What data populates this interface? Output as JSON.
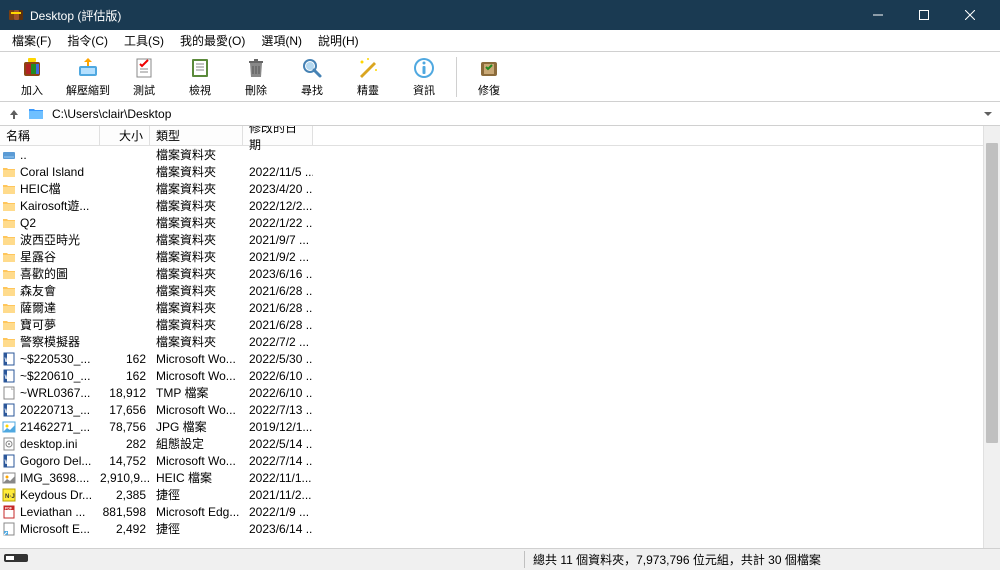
{
  "titlebar": {
    "title": "Desktop (評估版)"
  },
  "menubar": {
    "items": [
      {
        "label": "檔案(F)"
      },
      {
        "label": "指令(C)"
      },
      {
        "label": "工具(S)"
      },
      {
        "label": "我的最愛(O)"
      },
      {
        "label": "選項(N)"
      },
      {
        "label": "說明(H)"
      }
    ]
  },
  "toolbar": {
    "buttons": [
      {
        "label": "加入",
        "icon": "add"
      },
      {
        "label": "解壓縮到",
        "icon": "extract"
      },
      {
        "label": "測試",
        "icon": "test"
      },
      {
        "label": "檢視",
        "icon": "view"
      },
      {
        "label": "刪除",
        "icon": "delete"
      },
      {
        "label": "尋找",
        "icon": "find"
      },
      {
        "label": "精靈",
        "icon": "wizard"
      },
      {
        "label": "資訊",
        "icon": "info"
      },
      {
        "label": "修復",
        "icon": "repair"
      }
    ]
  },
  "addressbar": {
    "path": "C:\\Users\\clair\\Desktop"
  },
  "columns": {
    "name": "名稱",
    "size": "大小",
    "type": "類型",
    "date": "修改的日期"
  },
  "files": [
    {
      "icon": "drive",
      "name": "..",
      "size": "",
      "type": "檔案資料夾",
      "date": ""
    },
    {
      "icon": "folder",
      "name": "Coral Island",
      "size": "",
      "type": "檔案資料夾",
      "date": "2022/11/5 ..."
    },
    {
      "icon": "folder",
      "name": "HEIC檔",
      "size": "",
      "type": "檔案資料夾",
      "date": "2023/4/20 ..."
    },
    {
      "icon": "folder",
      "name": "Kairosoft遊...",
      "size": "",
      "type": "檔案資料夾",
      "date": "2022/12/2..."
    },
    {
      "icon": "folder",
      "name": "Q2",
      "size": "",
      "type": "檔案資料夾",
      "date": "2022/1/22 ..."
    },
    {
      "icon": "folder",
      "name": "波西亞時光",
      "size": "",
      "type": "檔案資料夾",
      "date": "2021/9/7 ..."
    },
    {
      "icon": "folder",
      "name": "星露谷",
      "size": "",
      "type": "檔案資料夾",
      "date": "2021/9/2 ..."
    },
    {
      "icon": "folder",
      "name": "喜歡的圖",
      "size": "",
      "type": "檔案資料夾",
      "date": "2023/6/16 ..."
    },
    {
      "icon": "folder",
      "name": "森友會",
      "size": "",
      "type": "檔案資料夾",
      "date": "2021/6/28 ..."
    },
    {
      "icon": "folder",
      "name": "薩爾達",
      "size": "",
      "type": "檔案資料夾",
      "date": "2021/6/28 ..."
    },
    {
      "icon": "folder",
      "name": "寶可夢",
      "size": "",
      "type": "檔案資料夾",
      "date": "2021/6/28 ..."
    },
    {
      "icon": "folder",
      "name": "警察模擬器",
      "size": "",
      "type": "檔案資料夾",
      "date": "2022/7/2 ..."
    },
    {
      "icon": "word",
      "name": "~$220530_...",
      "size": "162",
      "type": "Microsoft Wo...",
      "date": "2022/5/30 ..."
    },
    {
      "icon": "word",
      "name": "~$220610_...",
      "size": "162",
      "type": "Microsoft Wo...",
      "date": "2022/6/10 ..."
    },
    {
      "icon": "tmp",
      "name": "~WRL0367...",
      "size": "18,912",
      "type": "TMP 檔案",
      "date": "2022/6/10 ..."
    },
    {
      "icon": "word",
      "name": "20220713_...",
      "size": "17,656",
      "type": "Microsoft Wo...",
      "date": "2022/7/13 ..."
    },
    {
      "icon": "jpg",
      "name": "21462271_...",
      "size": "78,756",
      "type": "JPG 檔案",
      "date": "2019/12/1..."
    },
    {
      "icon": "ini",
      "name": "desktop.ini",
      "size": "282",
      "type": "組態設定",
      "date": "2022/5/14 ..."
    },
    {
      "icon": "word",
      "name": "Gogoro Del...",
      "size": "14,752",
      "type": "Microsoft Wo...",
      "date": "2022/7/14 ..."
    },
    {
      "icon": "heic",
      "name": "IMG_3698....",
      "size": "2,910,9...",
      "type": "HEIC 檔案",
      "date": "2022/11/1..."
    },
    {
      "icon": "lnk",
      "name": "Keydous Dr...",
      "size": "2,385",
      "type": "捷徑",
      "date": "2021/11/2..."
    },
    {
      "icon": "pdf",
      "name": "Leviathan ...",
      "size": "881,598",
      "type": "Microsoft Edg...",
      "date": "2022/1/9 ..."
    },
    {
      "icon": "lnk2",
      "name": "Microsoft E...",
      "size": "2,492",
      "type": "捷徑",
      "date": "2023/6/14 ..."
    }
  ],
  "statusbar": {
    "text": "總共 11 個資料夾，7,973,796 位元組，共計 30 個檔案"
  }
}
